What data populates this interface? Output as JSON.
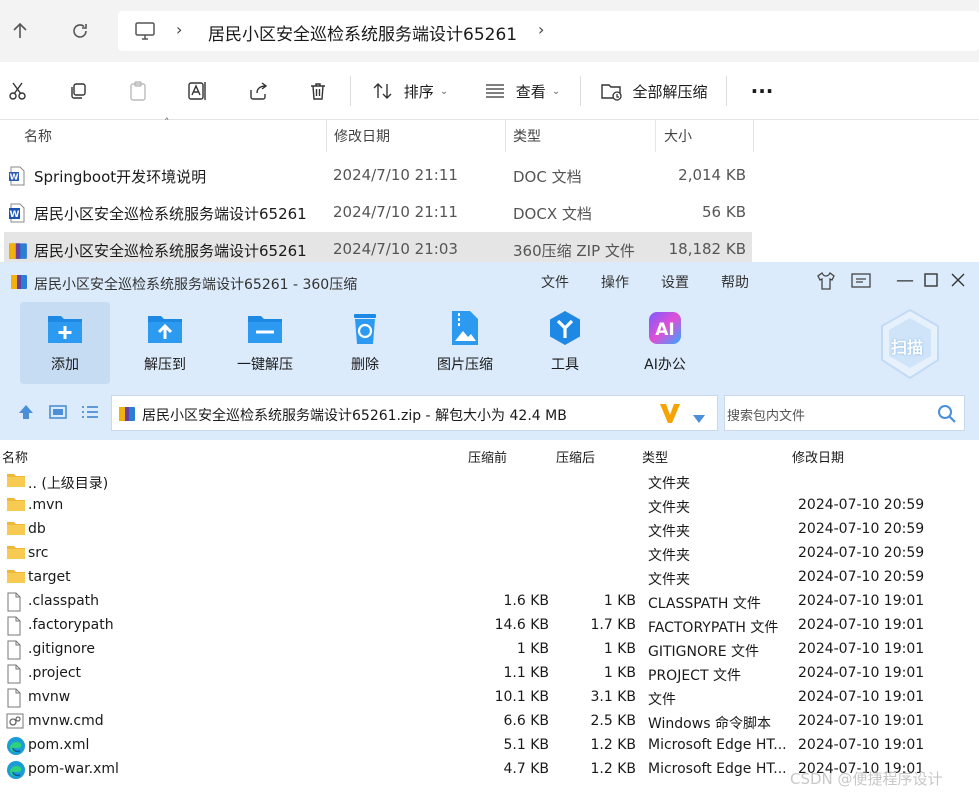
{
  "explorer": {
    "breadcrumb": "居民小区安全巡检系统服务端设计65261",
    "toolbar": {
      "sort_label": "排序",
      "view_label": "查看",
      "extract_all_label": "全部解压缩"
    },
    "columns": {
      "name": "名称",
      "modified": "修改日期",
      "type": "类型",
      "size": "大小"
    },
    "files": [
      {
        "name": "Springboot开发环境说明",
        "modified": "2024/7/10 21:11",
        "type": "DOC 文档",
        "size": "2,014 KB",
        "icon": "word-doc-icon"
      },
      {
        "name": "居民小区安全巡检系统服务端设计65261",
        "modified": "2024/7/10 21:11",
        "type": "DOCX 文档",
        "size": "56 KB",
        "icon": "word-docx-icon"
      },
      {
        "name": "居民小区安全巡检系统服务端设计65261",
        "modified": "2024/7/10 21:03",
        "type": "360压缩 ZIP 文件",
        "size": "18,182 KB",
        "icon": "zip-archive-icon"
      }
    ]
  },
  "zip": {
    "title": "居民小区安全巡检系统服务端设计65261 - 360压缩",
    "menu": [
      "文件",
      "操作",
      "设置",
      "帮助"
    ],
    "tools": [
      {
        "label": "添加",
        "icon": "add-folder-icon"
      },
      {
        "label": "解压到",
        "icon": "extract-to-icon"
      },
      {
        "label": "一键解压",
        "icon": "one-click-extract-icon"
      },
      {
        "label": "删除",
        "icon": "recycle-bin-icon"
      },
      {
        "label": "图片压缩",
        "icon": "image-compress-icon"
      },
      {
        "label": "工具",
        "icon": "tools-icon"
      },
      {
        "label": "AI办公",
        "icon": "ai-office-icon"
      }
    ],
    "scan_label": "扫描",
    "path": "居民小区安全巡检系统服务端设计65261.zip - 解包大小为 42.4 MB",
    "search_placeholder": "搜索包内文件",
    "columns": {
      "name": "名称",
      "before": "压缩前",
      "after": "压缩后",
      "type": "类型",
      "modified": "修改日期"
    },
    "entries": [
      {
        "name": ".. (上级目录)",
        "before": "",
        "after": "",
        "type": "文件夹",
        "modified": "",
        "icon": "folder-icon"
      },
      {
        "name": ".mvn",
        "before": "",
        "after": "",
        "type": "文件夹",
        "modified": "2024-07-10 20:59",
        "icon": "folder-icon"
      },
      {
        "name": "db",
        "before": "",
        "after": "",
        "type": "文件夹",
        "modified": "2024-07-10 20:59",
        "icon": "folder-icon"
      },
      {
        "name": "src",
        "before": "",
        "after": "",
        "type": "文件夹",
        "modified": "2024-07-10 20:59",
        "icon": "folder-icon"
      },
      {
        "name": "target",
        "before": "",
        "after": "",
        "type": "文件夹",
        "modified": "2024-07-10 20:59",
        "icon": "folder-icon"
      },
      {
        "name": ".classpath",
        "before": "1.6 KB",
        "after": "1 KB",
        "type": "CLASSPATH 文件",
        "modified": "2024-07-10 19:01",
        "icon": "file-icon"
      },
      {
        "name": ".factorypath",
        "before": "14.6 KB",
        "after": "1.7 KB",
        "type": "FACTORYPATH 文件",
        "modified": "2024-07-10 19:01",
        "icon": "file-icon"
      },
      {
        "name": ".gitignore",
        "before": "1 KB",
        "after": "1 KB",
        "type": "GITIGNORE 文件",
        "modified": "2024-07-10 19:01",
        "icon": "file-icon"
      },
      {
        "name": ".project",
        "before": "1.1 KB",
        "after": "1 KB",
        "type": "PROJECT 文件",
        "modified": "2024-07-10 19:01",
        "icon": "file-icon"
      },
      {
        "name": "mvnw",
        "before": "10.1 KB",
        "after": "3.1 KB",
        "type": "文件",
        "modified": "2024-07-10 19:01",
        "icon": "file-icon"
      },
      {
        "name": "mvnw.cmd",
        "before": "6.6 KB",
        "after": "2.5 KB",
        "type": "Windows 命令脚本",
        "modified": "2024-07-10 19:01",
        "icon": "cmd-script-icon"
      },
      {
        "name": "pom.xml",
        "before": "5.1 KB",
        "after": "1.2 KB",
        "type": "Microsoft Edge HT...",
        "modified": "2024-07-10 19:01",
        "icon": "edge-icon"
      },
      {
        "name": "pom-war.xml",
        "before": "4.7 KB",
        "after": "1.2 KB",
        "type": "Microsoft Edge HT...",
        "modified": "2024-07-10 19:01",
        "icon": "edge-icon"
      }
    ]
  },
  "watermark": "CSDN @便捷程序设计"
}
